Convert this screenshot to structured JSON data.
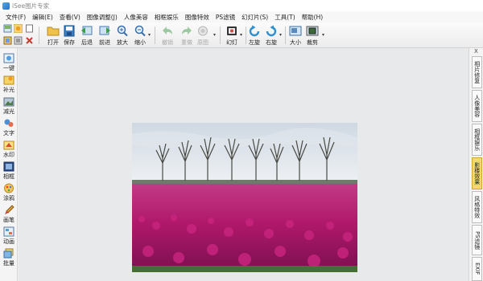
{
  "window": {
    "title": "iSee图片专家"
  },
  "menu": [
    "文件(F)",
    "编辑(E)",
    "查看(V)",
    "图像调整(J)",
    "人像美容",
    "相框娱乐",
    "图像特效",
    "PS滤镜",
    "幻灯片(S)",
    "工具(T)",
    "帮助(H)"
  ],
  "toolbar": {
    "buttons": [
      {
        "label": "打开",
        "icon": "folder-open-icon",
        "enabled": true
      },
      {
        "label": "保存",
        "icon": "save-icon",
        "enabled": true
      },
      {
        "label": "后退",
        "icon": "back-image-icon",
        "enabled": true
      },
      {
        "label": "前进",
        "icon": "forward-image-icon",
        "enabled": true
      },
      {
        "label": "放大",
        "icon": "zoom-in-icon",
        "enabled": true
      },
      {
        "label": "缩小",
        "icon": "zoom-out-icon",
        "enabled": true
      },
      {
        "label": "撤销",
        "icon": "undo-icon",
        "enabled": false
      },
      {
        "label": "重做",
        "icon": "redo-icon",
        "enabled": false
      },
      {
        "label": "原图",
        "icon": "original-image-icon",
        "enabled": false
      },
      {
        "label": "幻灯",
        "icon": "slideshow-icon",
        "enabled": true
      },
      {
        "label": "左旋",
        "icon": "rotate-left-icon",
        "enabled": true
      },
      {
        "label": "右旋",
        "icon": "rotate-right-icon",
        "enabled": true
      },
      {
        "label": "大小",
        "icon": "resize-icon",
        "enabled": true
      },
      {
        "label": "裁剪",
        "icon": "crop-icon",
        "enabled": true
      }
    ]
  },
  "left_tools": [
    {
      "label": "一键",
      "icon": "one-click-enhance-icon"
    },
    {
      "label": "补光",
      "icon": "fill-light-icon"
    },
    {
      "label": "减光",
      "icon": "reduce-light-icon"
    },
    {
      "label": "文字",
      "icon": "text-icon"
    },
    {
      "label": "水印",
      "icon": "watermark-icon"
    },
    {
      "label": "相框",
      "icon": "photo-frame-icon"
    },
    {
      "label": "涂鸦",
      "icon": "doodle-icon"
    },
    {
      "label": "画笔",
      "icon": "brush-icon"
    },
    {
      "label": "动画",
      "icon": "animation-icon"
    },
    {
      "label": "批量",
      "icon": "batch-icon"
    }
  ],
  "right_tabs": [
    {
      "label": "相片修复",
      "active": false
    },
    {
      "label": "人像美容",
      "active": false
    },
    {
      "label": "相框娱乐",
      "active": false
    },
    {
      "label": "影楼效果",
      "active": true
    },
    {
      "label": "风格特效",
      "active": false
    },
    {
      "label": "PS滤镜",
      "active": false
    },
    {
      "label": "EXIF",
      "active": false
    }
  ],
  "right_panel": {
    "close_label": "X"
  },
  "image": {
    "description_icon": "tulip-field-photo"
  },
  "colors": {
    "active_tab": "#f6d86a",
    "tulip": "#b0186a",
    "sky": "#e6ecf2"
  }
}
